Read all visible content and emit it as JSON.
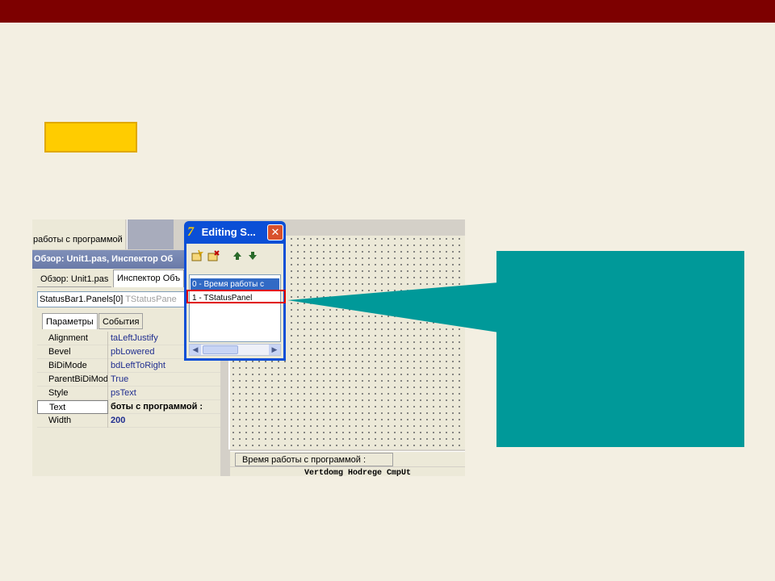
{
  "slide": {
    "header_color": "#7d0000",
    "background": "#f3efe2",
    "marker_color": "#ffcc00",
    "callout_color": "#009999"
  },
  "ide": {
    "top_strip_text": "работы с программой",
    "inspector": {
      "title": "Обзор: Unit1.pas, Инспектор Об",
      "tabs": [
        "Обзор: Unit1.pas",
        "Инспектор Объ"
      ],
      "selected_object": "StatusBar1.Panels[0]",
      "selected_type": "TStatusPane",
      "prop_tabs": [
        "Параметры",
        "События"
      ],
      "properties": [
        {
          "name": "Alignment",
          "value": "taLeftJustify"
        },
        {
          "name": "Bevel",
          "value": "pbLowered"
        },
        {
          "name": "BiDiMode",
          "value": "bdLeftToRight"
        },
        {
          "name": "ParentBiDiMod",
          "value": "True"
        },
        {
          "name": "Style",
          "value": "psText"
        },
        {
          "name": "Text",
          "value": "боты с программой :"
        },
        {
          "name": "Width",
          "value": "200"
        }
      ]
    },
    "dialog": {
      "title": "Editing S...",
      "close_glyph": "✕",
      "toolbar": [
        "add-new-icon",
        "delete-icon",
        "move-up-icon",
        "move-down-icon"
      ],
      "items": [
        "0 -    Время работы с",
        "1 - TStatusPanel"
      ]
    },
    "status_bar_text": "Время работы с программой :",
    "bottom_text": "Vertdomg  Hodrege  CmpUt"
  }
}
